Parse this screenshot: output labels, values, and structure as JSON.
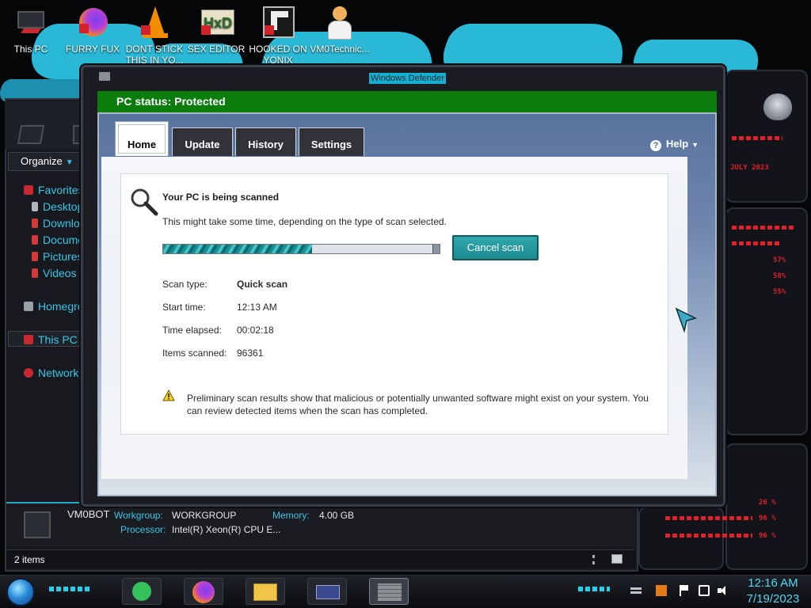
{
  "desktop": {
    "icons": [
      {
        "label": "This PC",
        "icon": "monitor-icon"
      },
      {
        "label": "FURRY FUX",
        "icon": "firefox-icon"
      },
      {
        "label": "DONT STICK THIS IN YO...",
        "icon": "vlc-cone-icon"
      },
      {
        "label": "SEX EDITOR",
        "icon": "hxd-editor-icon"
      },
      {
        "label": "HOOKED ON YONIX",
        "icon": "app-icon"
      },
      {
        "label": "VM0Technic...",
        "icon": "doctor-avatar-icon"
      }
    ],
    "wallpaper_accent": "#29b8d6",
    "panel_texts": [
      "JULY 2023",
      "57%",
      "58%",
      "55%",
      "26 %",
      "96 %",
      "96 %"
    ]
  },
  "explorer": {
    "organize_label": "Organize",
    "nav": [
      {
        "label": "Favorites",
        "icon": "star-icon"
      },
      {
        "label": "Desktop",
        "icon": "desktop-icon"
      },
      {
        "label": "Downloads",
        "icon": "download-icon"
      },
      {
        "label": "Documents",
        "icon": "documents-icon"
      },
      {
        "label": "Pictures",
        "icon": "pictures-icon"
      },
      {
        "label": "Videos",
        "icon": "videos-icon"
      },
      {
        "label": "Homegroup",
        "icon": "homegroup-icon"
      },
      {
        "label": "This PC",
        "icon": "computer-icon"
      },
      {
        "label": "Network",
        "icon": "network-icon"
      }
    ],
    "details": {
      "computer_name": "VM0BOT",
      "workgroup_label": "Workgroup:",
      "workgroup_value": "WORKGROUP",
      "memory_label": "Memory:",
      "memory_value": "4.00 GB",
      "processor_label": "Processor:",
      "processor_value": "Intel(R) Xeon(R) CPU E..."
    },
    "status_items": "2 items"
  },
  "defender": {
    "title": "Windows Defender",
    "status": "PC status: Protected",
    "status_color": "#0a7d0c",
    "tabs": [
      "Home",
      "Update",
      "History",
      "Settings"
    ],
    "active_tab": "Home",
    "help_label": "Help",
    "scan": {
      "title": "Your PC is being scanned",
      "subtitle": "This might take some time, depending on the type of scan selected.",
      "progress": 0.54,
      "cancel_label": "Cancel scan",
      "scan_type_label": "Scan type:",
      "scan_type_value": "Quick scan",
      "start_time_label": "Start time:",
      "start_time_value": "12:13 AM",
      "elapsed_label": "Time elapsed:",
      "elapsed_value": "00:02:18",
      "items_label": "Items scanned:",
      "items_value": "96361",
      "warning": "Preliminary scan results show that malicious or potentially unwanted software might exist on your system. You can review detected items when the scan has completed."
    }
  },
  "taskbar": {
    "apps": [
      "notes-app-icon",
      "firefox-icon",
      "file-explorer-icon",
      "control-panel-icon",
      "firewall-icon"
    ],
    "time": "12:16 AM",
    "date": "7/19/2023",
    "accent": "#1fd3ef"
  }
}
